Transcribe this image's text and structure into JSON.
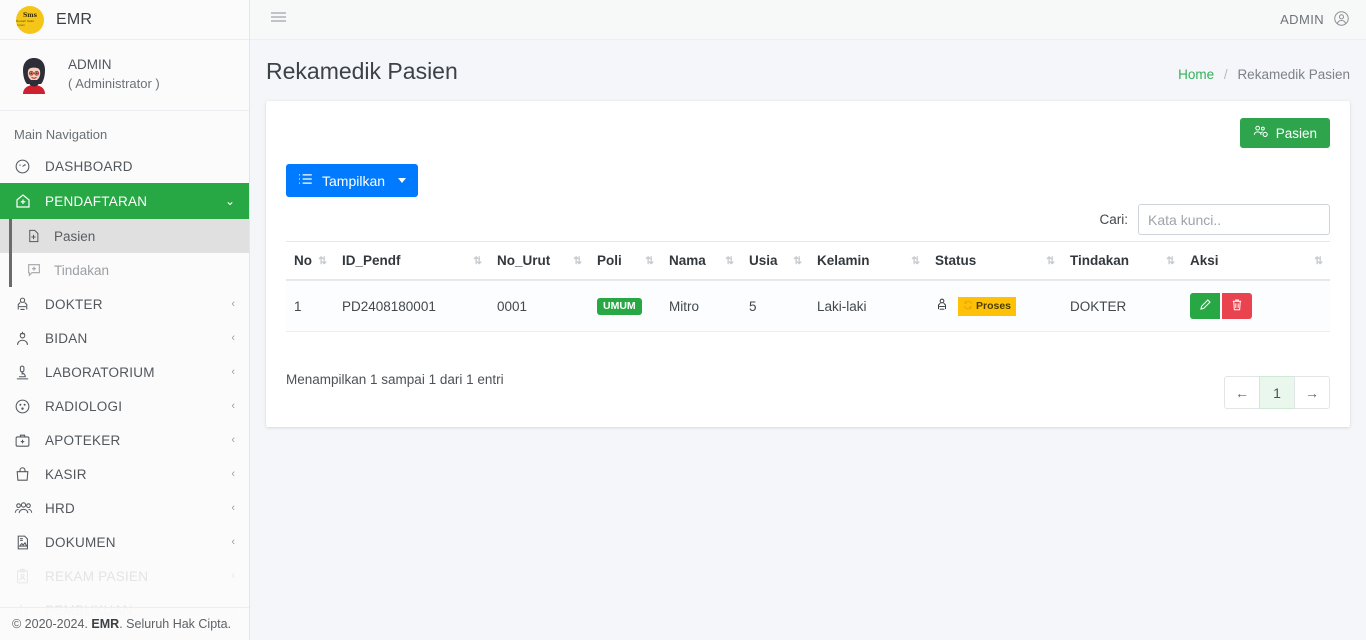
{
  "brand": {
    "name": "EMR",
    "logo_line1": "Sms",
    "logo_line2": "Rumah Sakit Umum"
  },
  "user_panel": {
    "name": "ADMIN",
    "role": "( Administrator )"
  },
  "topbar": {
    "user": "ADMIN",
    "menu_icon": "hamburger-icon",
    "user_icon": "user-circle-icon"
  },
  "sidebar": {
    "section_label": "Main Navigation",
    "items": [
      {
        "label": "DASHBOARD",
        "icon": "dashboard-icon",
        "caret": "",
        "state": "normal"
      },
      {
        "label": "PENDAFTARAN",
        "icon": "home-plus-icon",
        "caret": "⌄",
        "state": "active"
      },
      {
        "label": "DOKTER",
        "icon": "doctor-icon",
        "caret": "‹",
        "state": "normal"
      },
      {
        "label": "BIDAN",
        "icon": "midwife-icon",
        "caret": "‹",
        "state": "normal"
      },
      {
        "label": "LABORATORIUM",
        "icon": "microscope-icon",
        "caret": "‹",
        "state": "normal"
      },
      {
        "label": "RADIOLOGI",
        "icon": "radiology-icon",
        "caret": "‹",
        "state": "normal"
      },
      {
        "label": "APOTEKER",
        "icon": "medkit-icon",
        "caret": "‹",
        "state": "normal"
      },
      {
        "label": "KASIR",
        "icon": "bag-icon",
        "caret": "‹",
        "state": "normal"
      },
      {
        "label": "HRD",
        "icon": "users-icon",
        "caret": "‹",
        "state": "normal"
      },
      {
        "label": "DOKUMEN",
        "icon": "document-icon",
        "caret": "‹",
        "state": "normal"
      },
      {
        "label": "REKAM PASIEN",
        "icon": "clipboard-user-icon",
        "caret": "‹",
        "state": "faded"
      },
      {
        "label": "PEMBUKUAN",
        "icon": "chart-bar-icon",
        "caret": "‹",
        "state": "faded"
      }
    ],
    "subitems": [
      {
        "label": "Pasien",
        "icon": "file-plus-icon",
        "state": "selected"
      },
      {
        "label": "Tindakan",
        "icon": "comment-plus-icon",
        "state": "muted"
      }
    ],
    "footer": {
      "prefix": "© 2020-2024. ",
      "brand": "EMR",
      "suffix": ". Seluruh Hak Cipta."
    }
  },
  "page": {
    "title": "Rekamedik Pasien",
    "breadcrumb": {
      "home": "Home",
      "separator": "/",
      "current": "Rekamedik Pasien"
    }
  },
  "toolbar": {
    "pasien_button": "Pasien",
    "pasien_icon": "users-cog-icon",
    "tampilkan_button": "Tampilkan",
    "tampilkan_icon": "list-icon"
  },
  "search": {
    "label": "Cari:",
    "placeholder": "Kata kunci..",
    "value": ""
  },
  "table": {
    "columns": [
      "No",
      "ID_Pendf",
      "No_Urut",
      "Poli",
      "Nama",
      "Usia",
      "Kelamin",
      "Status",
      "Tindakan",
      "Aksi"
    ],
    "sort_icon": "sort-updown-icon",
    "rows": [
      {
        "no": "1",
        "id_pendf": "PD2408180001",
        "no_urut": "0001",
        "poli": "UMUM",
        "poli_color": "#28a745",
        "nama": "Mitro",
        "usia": "5",
        "kelamin": "Laki-laki",
        "status_icon": "user-md-icon",
        "status_badge": "Proses",
        "status_badge_icon": "sync-icon",
        "status_badge_color": "#ffc107",
        "tindakan": "DOKTER",
        "actions": [
          {
            "name": "edit",
            "icon": "pencil-icon",
            "color": "#28a745"
          },
          {
            "name": "delete",
            "icon": "trash-icon",
            "color": "#e9434f"
          }
        ]
      }
    ],
    "info": "Menampilkan 1 sampai 1 dari 1 entri",
    "pagination": {
      "prev": "←",
      "pages": [
        "1"
      ],
      "next": "→",
      "current": "1"
    }
  },
  "colors": {
    "brand_yellow": "#f5c518",
    "primary_green": "#28a745",
    "primary_blue": "#007bff",
    "warning_yellow": "#ffc107",
    "danger_red": "#e9434f"
  }
}
